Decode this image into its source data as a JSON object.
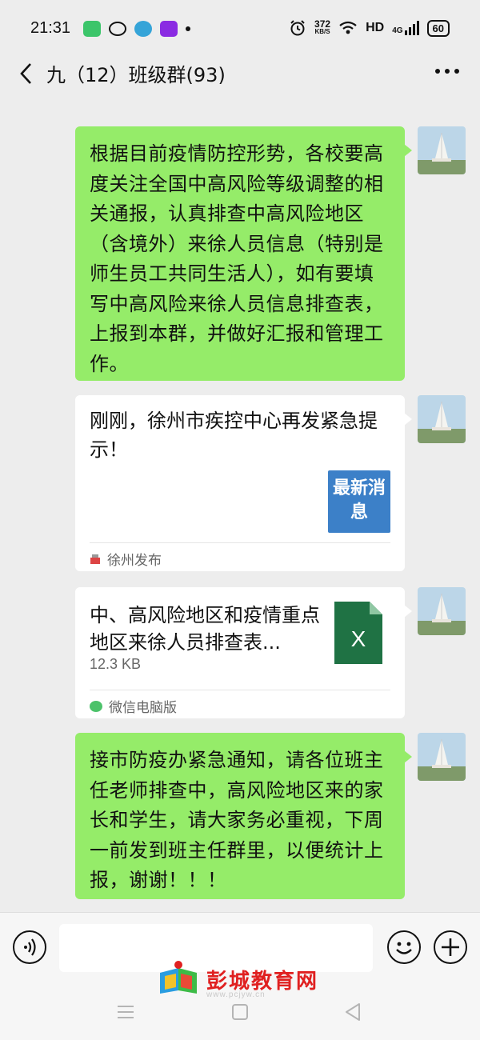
{
  "status_bar": {
    "time": "21:31",
    "net_speed_value": "372",
    "net_speed_unit": "KB/S",
    "hd": "HD",
    "signal": "4G",
    "battery": "60",
    "app_icons": [
      "wechat-green-icon",
      "weibo-icon",
      "mobile-icon",
      "video-icon"
    ]
  },
  "header": {
    "back_icon": "chevron-left-icon",
    "title": "九（12）班级群(93)",
    "more_icon": "more-dots-icon"
  },
  "messages": [
    {
      "type": "text",
      "text": "根据目前疫情防控形势，各校要高度关注全国中高风险等级调整的相关通报，认真排查中高风险地区（含境外）来徐人员信息（特别是师生员工共同生活人），如有要填写中高风险来徐人员信息排查表，上报到本群，并做好汇报和管理工作。"
    },
    {
      "type": "article",
      "title": "刚刚，徐州市疾控中心再发紧急提示！",
      "thumb_text": "最新消息",
      "source": "徐州发布"
    },
    {
      "type": "file",
      "file_name": "中、高风险地区和疫情重点地区来徐人员排查表...",
      "file_size": "12.3 KB",
      "file_icon_label": "X",
      "source": "微信电脑版"
    },
    {
      "type": "text",
      "text": "接市防疫办紧急通知，请各位班主任老师排查中，高风险地区来的家长和学生，请大家务必重视，下周一前发到班主任群里，以便统计上报，谢谢！！！"
    }
  ],
  "input_bar": {
    "voice_icon": "voice-icon",
    "input_value": "",
    "emoji_icon": "emoji-icon",
    "plus_icon": "plus-icon"
  },
  "watermark": {
    "text": "彭城教育网",
    "sub": "www.pcjyw.cn"
  },
  "colors": {
    "background": "#ededed",
    "bubble_self": "#95ec69",
    "card": "#ffffff",
    "excel": "#1f7244",
    "thumb": "#3c80c8",
    "watermark": "#e02020"
  }
}
